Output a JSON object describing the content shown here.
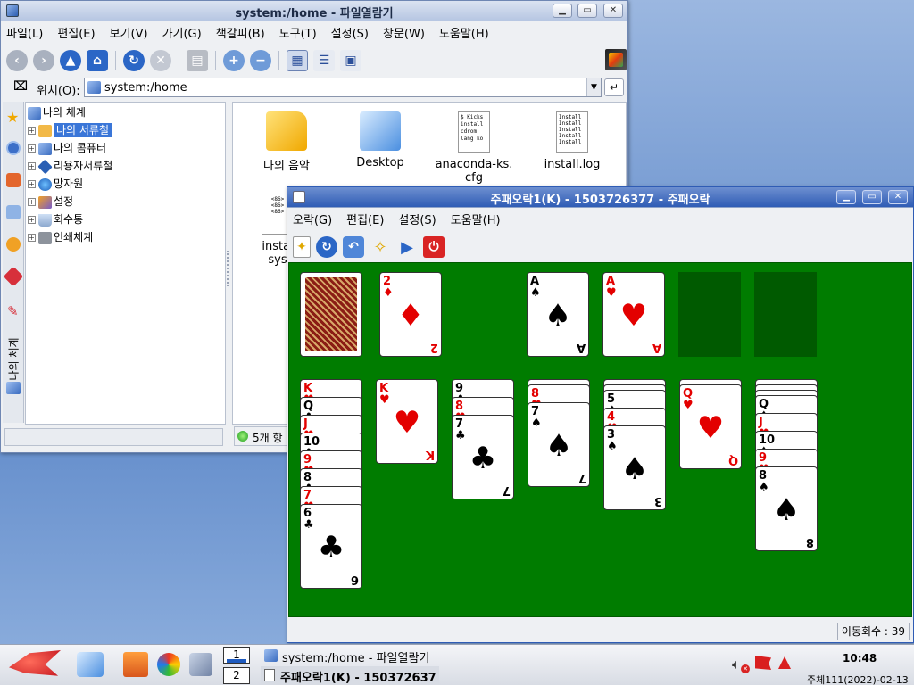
{
  "filemanager": {
    "title": "system:/home - 파일열람기",
    "menu": [
      "파일(L)",
      "편집(E)",
      "보기(V)",
      "가기(G)",
      "책갈피(B)",
      "도구(T)",
      "설정(S)",
      "창문(W)",
      "도움말(H)"
    ],
    "location_label": "위치(O):",
    "location_value": "system:/home",
    "tree": [
      "나의 체계",
      "나의 서류철",
      "나의 콤퓨터",
      "리용자서류철",
      "망자원",
      "설정",
      "회수통",
      "인쇄체계"
    ],
    "files": [
      "나의 음악",
      "Desktop",
      "anaconda-ks.cfg",
      "install.log",
      "install.log.syslog"
    ],
    "file_labels_visible": [
      "나의 음악",
      "Desktop",
      "anaconda-ks.\ncfg",
      "install.log",
      "instal\nsys"
    ],
    "status": "5개 항",
    "side_tab": "나의 체계",
    "icons": [
      "back-icon",
      "forward-icon",
      "up-icon",
      "home-icon",
      "reload-icon",
      "stop-icon",
      "print-icon",
      "zoom-in-icon",
      "zoom-out-icon",
      "icon-view",
      "detail-view",
      "image-view"
    ]
  },
  "solitaire": {
    "title": "주패오락1(K) - 1503726377 - 주패오락",
    "menu": [
      "오락(G)",
      "편집(E)",
      "설정(S)",
      "도움말(H)"
    ],
    "status": "이동회수 : 39",
    "table_color": "#007c00",
    "stock": {
      "waste_rank": "2",
      "waste_suit": "♦"
    },
    "foundations": [
      {
        "rank": "A",
        "suit": "♠"
      },
      {
        "rank": "A",
        "suit": "♥"
      }
    ],
    "tableau": [
      {
        "cards": [
          [
            "K",
            "♥"
          ],
          [
            "Q",
            "♣"
          ],
          [
            "J",
            "♥"
          ],
          [
            "10",
            "♣"
          ],
          [
            "9",
            "♥"
          ],
          [
            "8",
            "♣"
          ],
          [
            "7",
            "♥"
          ],
          [
            "6",
            "♣"
          ]
        ]
      },
      {
        "cards": [
          [
            "K",
            "♥"
          ]
        ]
      },
      {
        "cards": [
          [
            "9",
            "♣"
          ],
          [
            "8",
            "♥"
          ],
          [
            "7",
            "♣"
          ]
        ]
      },
      {
        "cards": [
          [
            "8",
            "♥"
          ],
          [
            "7",
            "♠"
          ]
        ]
      },
      {
        "cards": [
          [
            "5",
            "♠"
          ],
          [
            "4",
            "♥"
          ],
          [
            "3",
            "♠"
          ]
        ]
      },
      {
        "cards": [
          [
            "Q",
            "♥"
          ]
        ]
      },
      {
        "cards": [
          [
            "Q",
            "♠"
          ],
          [
            "J",
            "♥"
          ],
          [
            "10",
            "♠"
          ],
          [
            "9",
            "♥"
          ],
          [
            "8",
            "♠"
          ]
        ]
      }
    ]
  },
  "taskbar": {
    "desktops": [
      "1",
      "2"
    ],
    "tasks": [
      "system:/home - 파일열람기",
      "주패오락1(K) - 150372637"
    ],
    "clock": "10:48",
    "date": "주체111(2022)-02-13"
  }
}
